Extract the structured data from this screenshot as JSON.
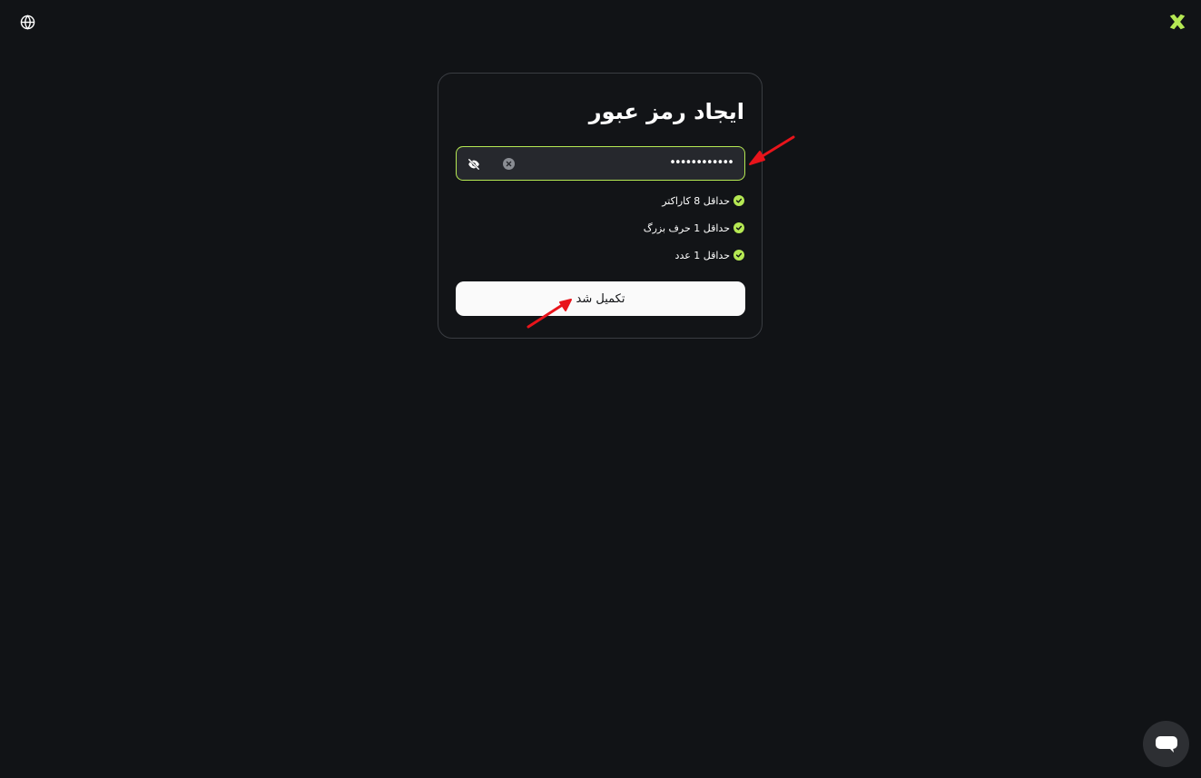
{
  "header": {
    "globe_icon": "globe-icon",
    "logo_icon": "x-logo-icon",
    "accent_color": "#b5e853"
  },
  "card": {
    "title": "ایجاد رمز عبور",
    "password_field": {
      "value": "••••••••••••",
      "eye_icon": "eye-off-icon",
      "clear_icon": "clear-icon"
    },
    "requirements": [
      {
        "label": "حداقل 8 کاراکتر",
        "met": true
      },
      {
        "label": "حداقل 1 حرف بزرگ",
        "met": true
      },
      {
        "label": "حداقل 1 عدد",
        "met": true
      }
    ],
    "submit_label": "تکمیل شد"
  },
  "annotation_color": "#e8141b",
  "chat": {
    "icon": "chat-bubble-icon"
  }
}
